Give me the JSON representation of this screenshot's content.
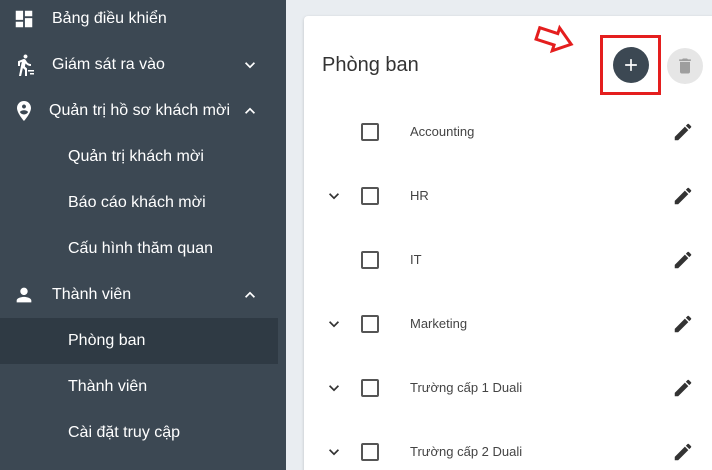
{
  "sidebar": {
    "items": [
      {
        "label": "Bảng điều khiển",
        "icon": "dashboard-icon"
      },
      {
        "label": "Giám sát ra vào",
        "icon": "walk-icon",
        "expanded": false
      },
      {
        "label": "Quản trị hồ sơ khách mời",
        "icon": "location-pin-icon",
        "expanded": true,
        "children": [
          {
            "label": "Quản trị khách mời"
          },
          {
            "label": "Báo cáo khách mời"
          },
          {
            "label": "Cấu hình thăm quan"
          }
        ]
      },
      {
        "label": "Thành viên",
        "icon": "person-icon",
        "expanded": true,
        "children": [
          {
            "label": "Phòng ban",
            "active": true
          },
          {
            "label": "Thành viên"
          },
          {
            "label": "Cài đặt truy cập"
          }
        ]
      }
    ]
  },
  "main": {
    "title": "Phòng ban",
    "departments": [
      {
        "name": "Accounting",
        "expandable": false
      },
      {
        "name": "HR",
        "expandable": true
      },
      {
        "name": "IT",
        "expandable": false
      },
      {
        "name": "Marketing",
        "expandable": true
      },
      {
        "name": "Trường cấp 1 Duali",
        "expandable": true
      },
      {
        "name": "Trường cấp 2 Duali",
        "expandable": true
      }
    ]
  },
  "colors": {
    "sidebar_bg": "#3c4853",
    "active_item_bg": "#2f3a44",
    "add_button_bg": "#3c4853",
    "highlight_red": "#e41e1e"
  }
}
